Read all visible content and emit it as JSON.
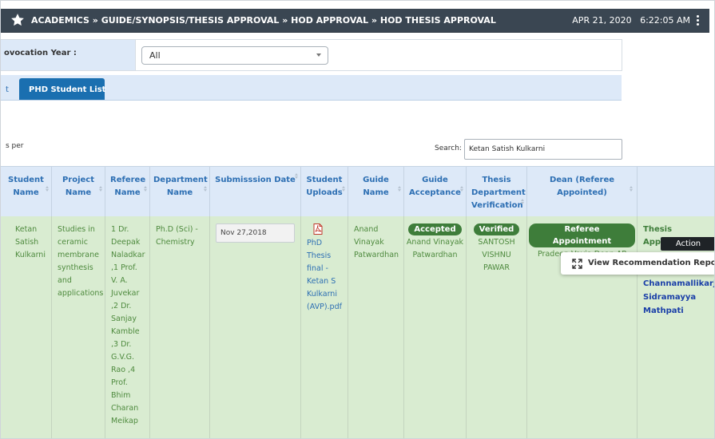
{
  "header": {
    "breadcrumb": "ACADEMICS » GUIDE/SYNOPSIS/THESIS APPROVAL » HOD APPROVAL » HOD THESIS APPROVAL",
    "date": "APR 21, 2020",
    "time": "6:22:05 AM"
  },
  "filter": {
    "label": "ovocation Year :",
    "selected": "All"
  },
  "tabs": {
    "previous": "t",
    "active": "PHD Student List"
  },
  "table_controls": {
    "entries_label": "s per",
    "search_label": "Search:",
    "search_value": "Ketan Satish Kulkarni"
  },
  "columns": [
    "Student Name",
    "Project Name",
    "Referee Name",
    "Department Name",
    "Submisssion Date",
    "Student Uploads",
    "Guide Name",
    "Guide Acceptance",
    "Thesis Department Verification",
    "Dean (Referee Appointed)",
    ""
  ],
  "row": {
    "student_name": "Ketan Satish Kulkarni",
    "project_name": "Studies in ceramic membrane synthesis and applications",
    "referee_name": "1 Dr. Deepak Naladkar ,1 Prof. V. A. Juvekar ,2 Dr. Sanjay Kamble ,3 Dr. G.V.G. Rao ,4 Prof. Bhim Charan Meikap",
    "department_name": "Ph.D (Sci) - Chemistry",
    "submission_date": "Nov 27,2018",
    "upload_file": "PhD Thesis final - Ketan S Kulkarni (AVP).pdf",
    "guide_name": "Anand Vinayak Patwardhan",
    "guide_acceptance_badge": "Accepted",
    "guide_acceptance_by": "Anand Vinayak Patwardhan",
    "verification_badge": "Verified",
    "verification_by": "SANTOSH VISHNU PAWAR",
    "dean_badge": "Referee Appointment",
    "dean_by": "Pradeep Vavia Dean AP",
    "status": "Thesis Approved",
    "action_label": "Action",
    "menu_item": "View Recommendation Report",
    "approver_names": [
      "Channamallikarj",
      "Sidramayya",
      "Mathpati"
    ]
  },
  "colors": {
    "header_bg": "#3a4652",
    "tab_active": "#1a6fb0",
    "row_bg": "#d9ecd1",
    "badge": "#3e7d3a",
    "link": "#2d6fb3"
  }
}
